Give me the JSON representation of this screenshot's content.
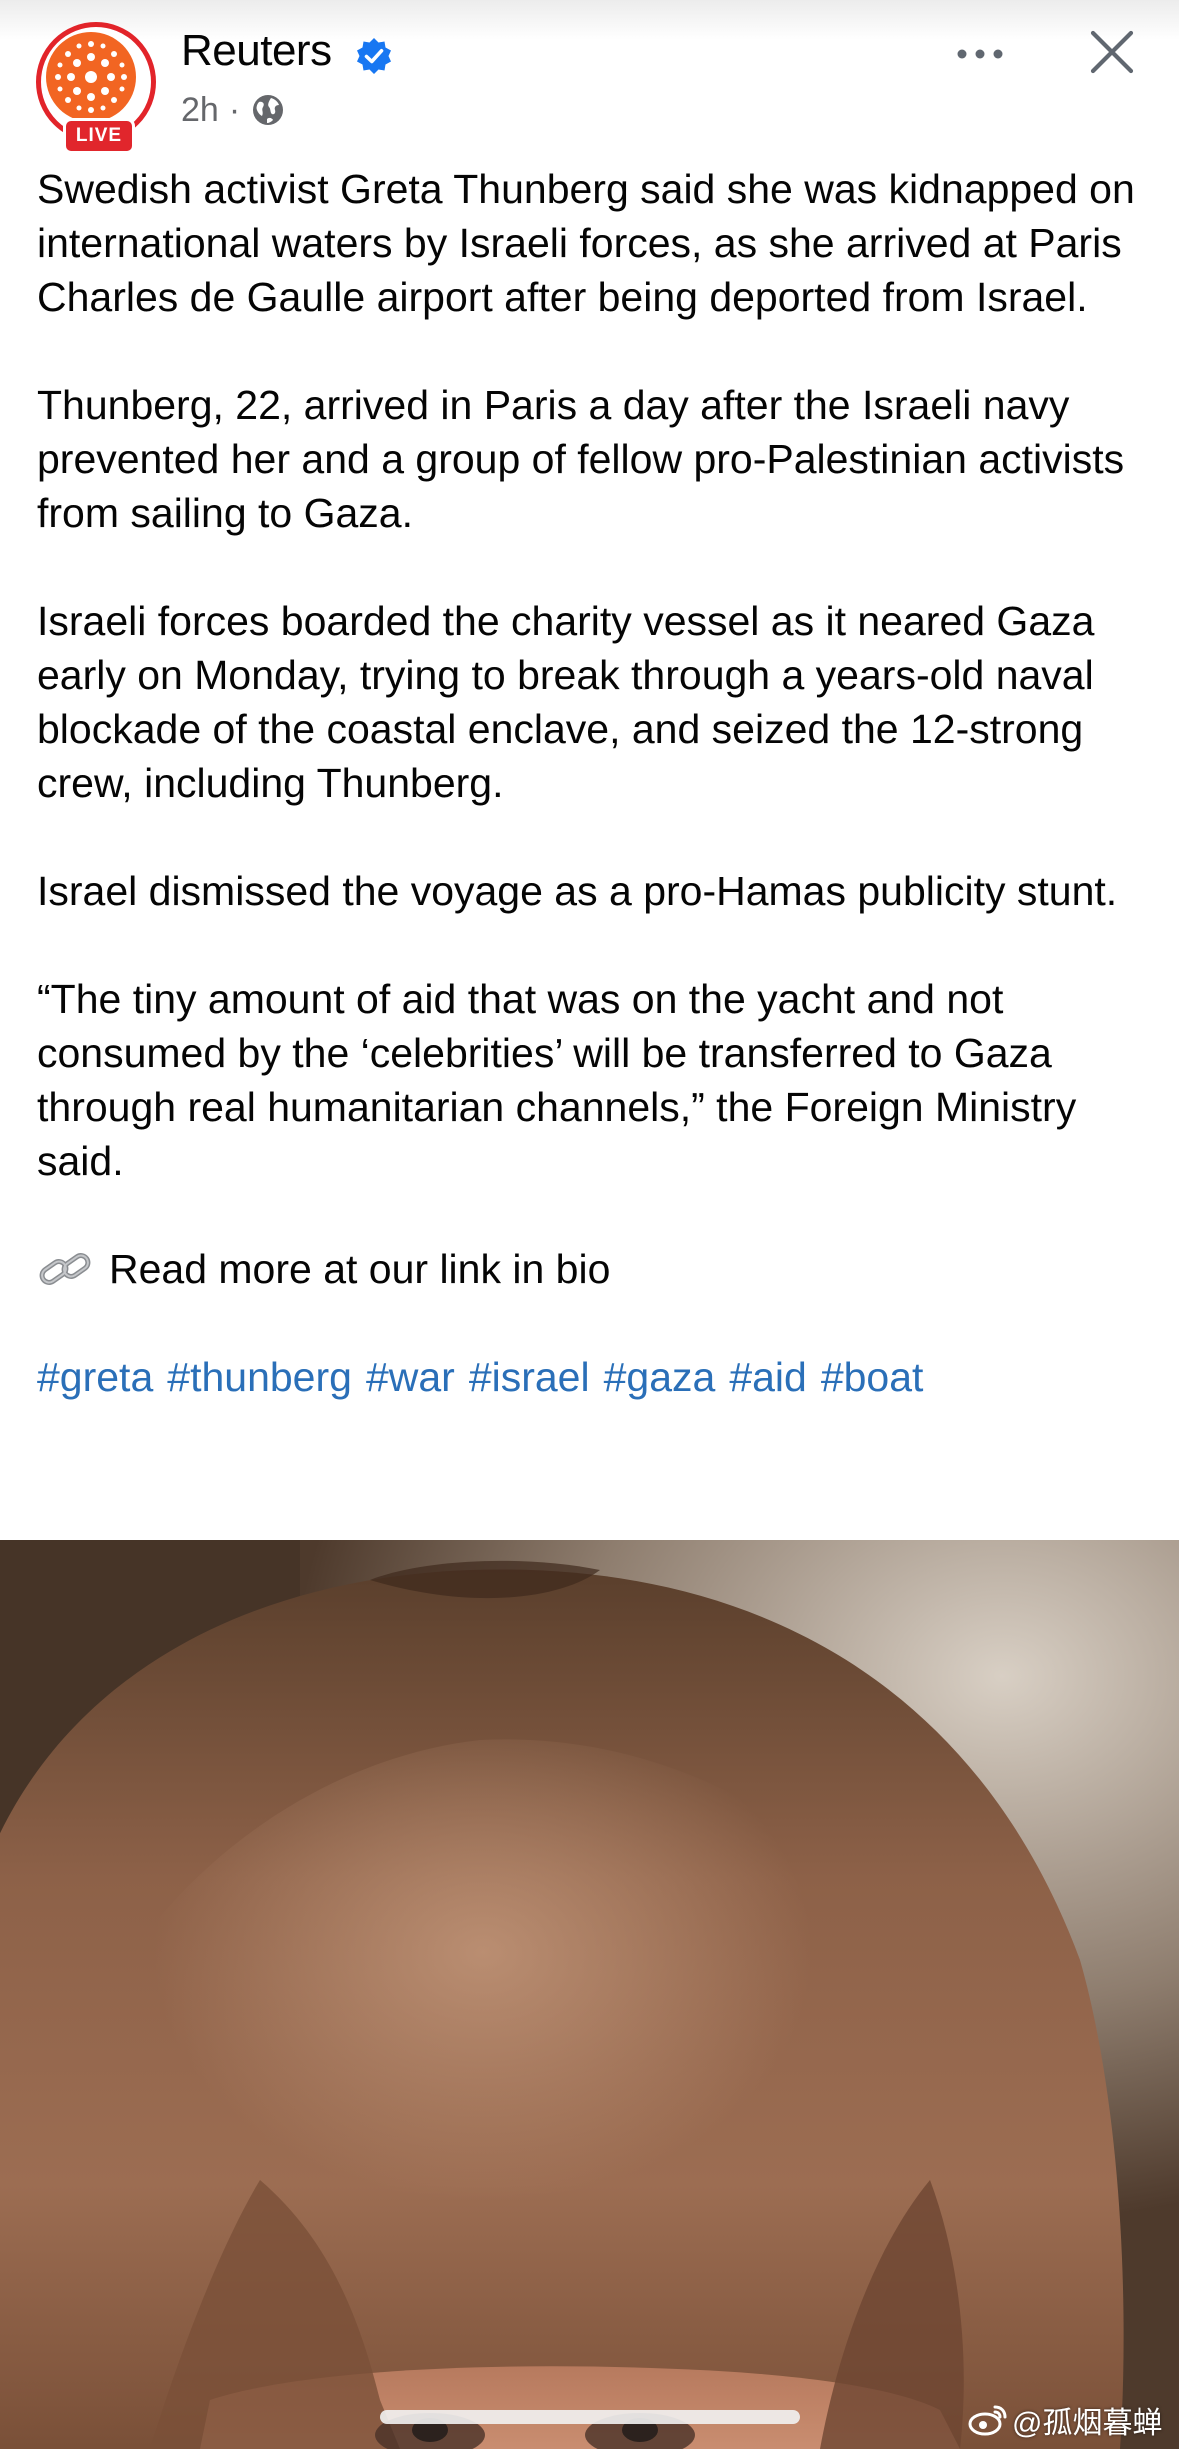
{
  "post": {
    "page_name": "Reuters",
    "live_badge": "LIVE",
    "timestamp": "2h",
    "separator": "·",
    "brand_color": "#f26522",
    "live_color": "#e1262c",
    "verified_color": "#1877f2",
    "hashtag_color": "#2a6fb8"
  },
  "header_icons": {
    "verified": "verified-badge-icon",
    "audience": "globe-icon",
    "more": "more-options-icon",
    "close": "close-icon"
  },
  "body": {
    "paragraphs": [
      "Swedish activist Greta Thunberg said she was kidnapped on international waters by Israeli forces, as she arrived at Paris Charles de Gaulle airport after being deported from Israel.",
      "Thunberg, 22, arrived in Paris a day after the Israeli navy prevented her and a group of fellow pro-Palestinian activists from sailing to Gaza.",
      "Israeli forces boarded the charity vessel as it neared Gaza early on Monday, trying to break through a years-old naval blockade of the coastal enclave, and seized the 12-strong crew, including Thunberg.",
      "Israel dismissed the voyage as a pro-Hamas publicity stunt.",
      "“The tiny amount of aid that was on the yacht and not consumed by the ‘celebrities’ will be transferred to Gaza through real humanitarian channels,” the Foreign Ministry said."
    ],
    "link_line": "Read more at our link in bio",
    "link_icon": "link-chain-icon",
    "hashtags": [
      "#greta",
      "#thunberg",
      "#war",
      "#israel",
      "#gaza",
      "#aid",
      "#boat"
    ]
  },
  "watermark": {
    "icon": "weibo-icon",
    "text": "@孤烟暮蝉"
  }
}
